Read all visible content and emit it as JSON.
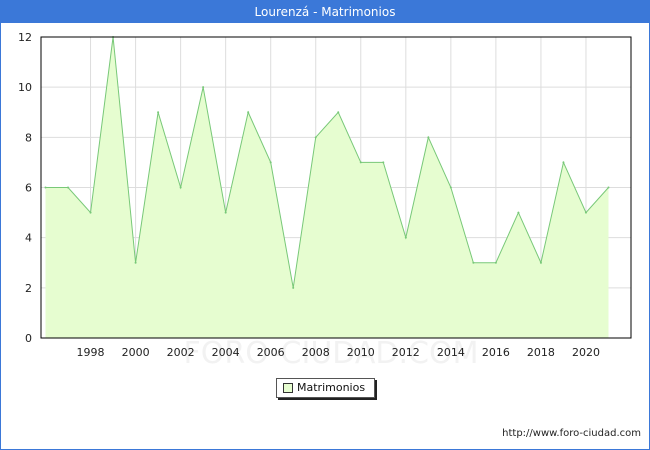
{
  "title": "Lourenzá - Matrimonios",
  "watermark": "FORO-CIUDAD.COM",
  "source_url": "http://www.foro-ciudad.com",
  "colors": {
    "header": "#3b78d8",
    "fill": "#e6fdd0",
    "line": "#78c878",
    "grid": "#dddddd"
  },
  "chart_data": {
    "type": "area",
    "x": [
      1996,
      1997,
      1998,
      1999,
      2000,
      2001,
      2002,
      2003,
      2004,
      2005,
      2006,
      2007,
      2008,
      2009,
      2010,
      2011,
      2012,
      2013,
      2014,
      2015,
      2016,
      2017,
      2018,
      2019,
      2020,
      2021
    ],
    "series": [
      {
        "name": "Matrimonios",
        "values": [
          6,
          6,
          5,
          12,
          3,
          9,
          6,
          10,
          5,
          9,
          7,
          2,
          8,
          9,
          7,
          7,
          4,
          8,
          6,
          3,
          3,
          5,
          3,
          7,
          5,
          6
        ]
      }
    ],
    "x_ticks": [
      "1998",
      "2000",
      "2002",
      "2004",
      "2006",
      "2008",
      "2010",
      "2012",
      "2014",
      "2016",
      "2018",
      "2020"
    ],
    "y_ticks": [
      "0",
      "2",
      "4",
      "6",
      "8",
      "10",
      "12"
    ],
    "xlim": [
      1995.8,
      2022
    ],
    "ylim": [
      0,
      12
    ],
    "grid": true,
    "legend": "bottom-center"
  }
}
